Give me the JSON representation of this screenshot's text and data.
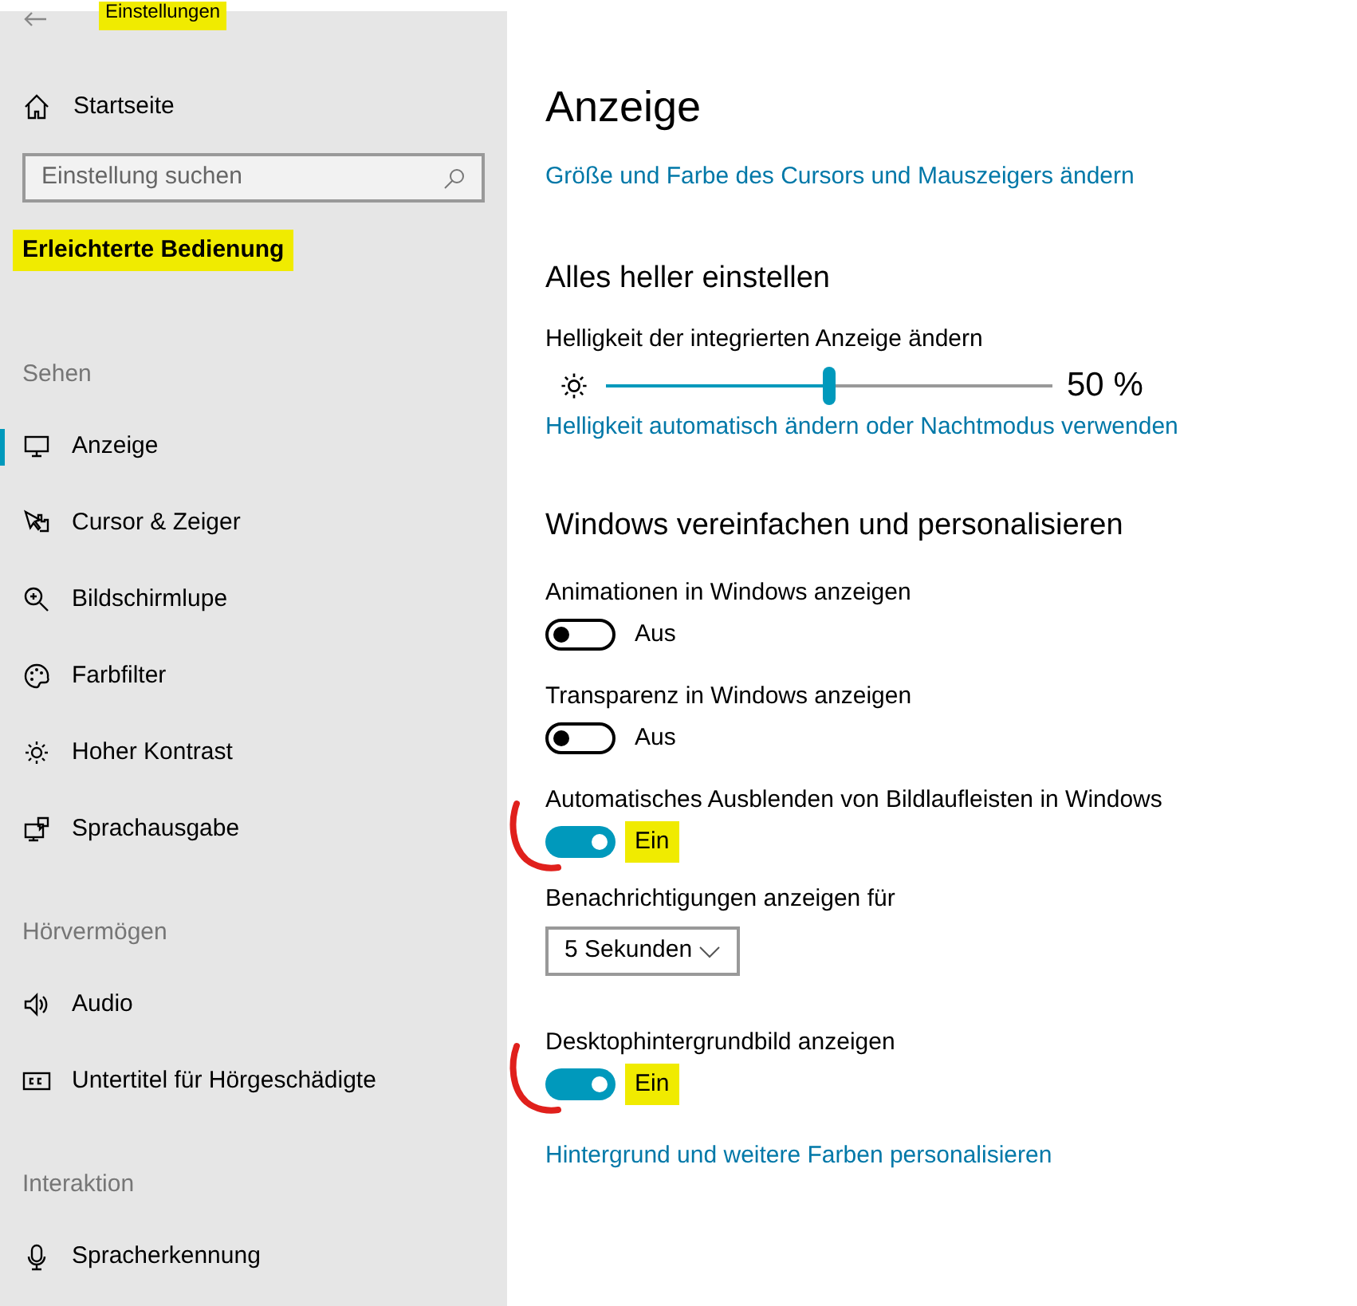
{
  "window": {
    "title": "Einstellungen",
    "title_highlighted": true
  },
  "sidebar": {
    "home": "Startseite",
    "search": {
      "placeholder": "Einstellung suchen"
    },
    "category": "Erleichterte Bedienung",
    "category_highlighted": true,
    "groups": [
      {
        "heading": "Sehen",
        "items": [
          {
            "kind": "display",
            "label": "Anzeige",
            "selected": true
          },
          {
            "kind": "cursor",
            "label": "Cursor & Zeiger",
            "selected": false
          },
          {
            "kind": "magnifier",
            "label": "Bildschirmlupe",
            "selected": false
          },
          {
            "kind": "palette",
            "label": "Farbfilter",
            "selected": false
          },
          {
            "kind": "contrast",
            "label": "Hoher Kontrast",
            "selected": false
          },
          {
            "kind": "narrator",
            "label": "Sprachausgabe",
            "selected": false
          }
        ]
      },
      {
        "heading": "Hörvermögen",
        "items": [
          {
            "kind": "audio",
            "label": "Audio",
            "selected": false
          },
          {
            "kind": "captions",
            "label": "Untertitel für Hörgeschädigte",
            "selected": false
          }
        ]
      },
      {
        "heading": "Interaktion",
        "items": [
          {
            "kind": "microphone",
            "label": "Spracherkennung",
            "selected": false
          }
        ]
      }
    ]
  },
  "main": {
    "title": "Anzeige",
    "link": "Größe und Farbe des Cursors und Mauszeigers ändern",
    "sections": [
      {
        "heading": "Alles heller einstellen",
        "settings": [
          {
            "kind": "slider",
            "label": "Helligkeit der integrierten Anzeige ändern",
            "level": 0.5,
            "reading": "50 %"
          },
          {
            "kind": "link",
            "label": "Helligkeit automatisch ändern oder Nachtmodus verwenden"
          }
        ]
      },
      {
        "heading": "Windows vereinfachen und personalisieren",
        "settings": [
          {
            "kind": "toggle",
            "label": "Animationen in Windows anzeigen",
            "on": false,
            "state_label": "Aus",
            "highlighted": false,
            "annotated": false
          },
          {
            "kind": "toggle",
            "label": "Transparenz in Windows anzeigen",
            "on": false,
            "state_label": "Aus",
            "highlighted": false,
            "annotated": false
          },
          {
            "kind": "toggle",
            "label": "Automatisches Ausblenden von Bildlaufleisten in Windows",
            "on": true,
            "state_label": "Ein",
            "highlighted": true,
            "annotated": true
          },
          {
            "kind": "dropdown",
            "label": "Benachrichtigungen anzeigen für",
            "value": "5 Sekunden"
          },
          {
            "kind": "toggle",
            "label": "Desktophintergrundbild anzeigen",
            "on": true,
            "state_label": "Ein",
            "highlighted": true,
            "annotated": true
          },
          {
            "kind": "link",
            "label": "Hintergrund und weitere Farben personalisieren"
          }
        ]
      }
    ]
  }
}
